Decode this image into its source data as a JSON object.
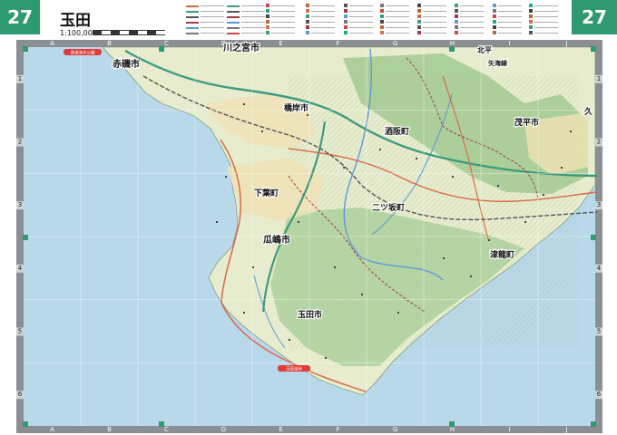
{
  "page": {
    "number": "27",
    "title": "玉田",
    "scale": "1:100,000"
  },
  "grid": {
    "columns": [
      "A",
      "B",
      "C",
      "D",
      "E",
      "F",
      "G",
      "H",
      "I",
      "J"
    ],
    "rows": [
      "1",
      "2",
      "3",
      "4",
      "5",
      "6"
    ]
  },
  "places": [
    {
      "id": "kawanomiya",
      "label": "川之宮市",
      "size": "large"
    },
    {
      "id": "akaiso",
      "label": "赤磯市",
      "size": "large"
    },
    {
      "id": "hashigishi",
      "label": "橋岸市",
      "size": "large"
    },
    {
      "id": "sakanocho",
      "label": "酒阪町",
      "size": "large"
    },
    {
      "id": "mohira",
      "label": "茂平市",
      "size": "large"
    },
    {
      "id": "shimoha",
      "label": "下葉町",
      "size": "large"
    },
    {
      "id": "futatsusaka",
      "label": "二ツ坂町",
      "size": "large"
    },
    {
      "id": "urimine",
      "label": "瓜嶋市",
      "size": "large"
    },
    {
      "id": "tsuryu",
      "label": "津龍町",
      "size": "large"
    },
    {
      "id": "tamada",
      "label": "玉田市",
      "size": "large"
    },
    {
      "id": "kita",
      "label": "北平",
      "size": "medium"
    },
    {
      "id": "kuji",
      "label": "久",
      "size": "medium"
    },
    {
      "id": "kaisen",
      "label": "矢海線",
      "size": "medium"
    }
  ],
  "badges": [
    {
      "id": "badge-top",
      "label": "滑浦海水公園"
    },
    {
      "id": "badge-bottom",
      "label": "玉田海岸"
    }
  ],
  "colors": {
    "tab": "#2f9a72",
    "sea": "#b9d8ea",
    "land": "#e6eccd",
    "forest": "#8fbf84",
    "river": "#5a9bd4",
    "highway": "#3f9a7f",
    "national_road": "#d96a4a",
    "rail": "#555555",
    "boundary": "#a0384a",
    "badge": "#e03b3b"
  }
}
